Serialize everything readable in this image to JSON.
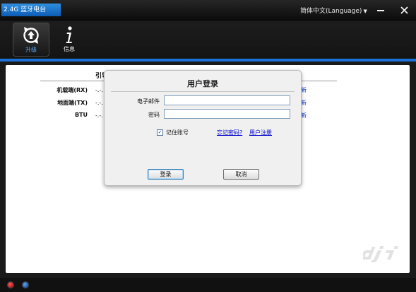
{
  "app": {
    "title": "2.4G 蓝牙电台",
    "language": "简体中文(Language)"
  },
  "toolbar": {
    "upgrade_label": "升级",
    "info_label": "信息"
  },
  "background": {
    "header": "引导",
    "rows": [
      {
        "label": "机载端(RX)",
        "value": "-.-.",
        "new": "新"
      },
      {
        "label": "地面端(TX)",
        "value": "-.-.",
        "new": "新"
      },
      {
        "label": "BTU",
        "value": "-.-.",
        "new": "新"
      }
    ]
  },
  "dialog": {
    "title": "用户登录",
    "email_label": "电子邮件",
    "email_value": "",
    "password_label": "密码",
    "password_value": "",
    "remember_label": "记住账号",
    "remember_checked": true,
    "forgot_link": "忘记密码?",
    "register_link": "用户注册",
    "login_button": "登录",
    "cancel_button": "取消"
  },
  "colors": {
    "accent": "#1d72d9",
    "title_badge": "#1566c4",
    "link": "#0000cc"
  }
}
